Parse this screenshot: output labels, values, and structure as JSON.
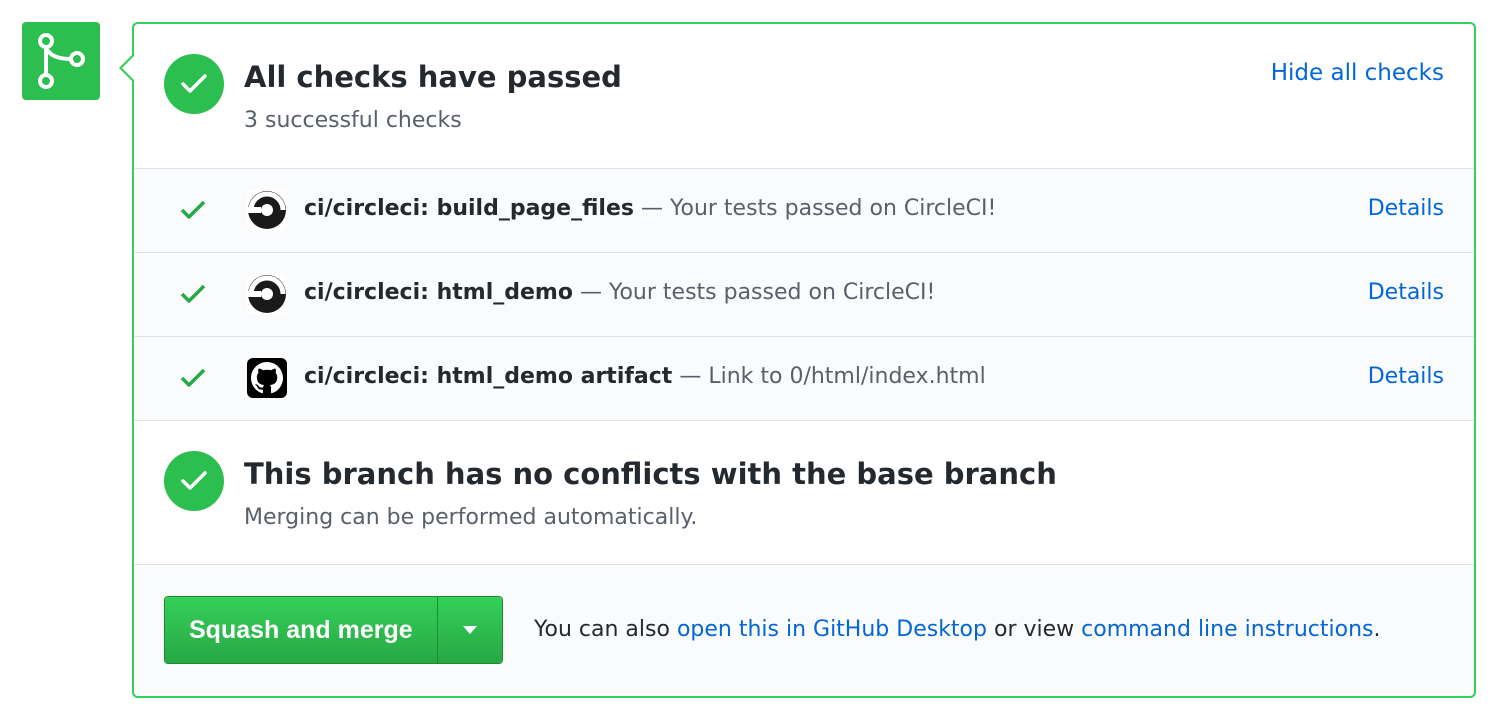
{
  "icons": {
    "merge": "git-merge-icon",
    "check": "check-icon",
    "circleci": "circleci-icon",
    "github": "github-icon",
    "caret": "triangle-down-icon"
  },
  "colors": {
    "success": "#2cbe4e",
    "border_success": "#34d058",
    "link": "#0366d6",
    "muted": "#586069"
  },
  "checks_summary": {
    "title": "All checks have passed",
    "subtitle": "3 successful checks",
    "toggle_label": "Hide all checks"
  },
  "checks": [
    {
      "name": "ci/circleci: build_page_files",
      "separator": " — ",
      "description": "Your tests passed on CircleCI!",
      "details_label": "Details",
      "avatar": "circleci-icon"
    },
    {
      "name": "ci/circleci: html_demo",
      "separator": " — ",
      "description": "Your tests passed on CircleCI!",
      "details_label": "Details",
      "avatar": "circleci-icon"
    },
    {
      "name": "ci/circleci: html_demo artifact",
      "separator": " — ",
      "description": "Link to 0/html/index.html",
      "details_label": "Details",
      "avatar": "github-icon"
    }
  ],
  "branch_status": {
    "title": "This branch has no conflicts with the base branch",
    "subtitle": "Merging can be performed automatically."
  },
  "merge": {
    "button_label": "Squash and merge",
    "note_prefix": "You can also ",
    "desktop_link": "open this in GitHub Desktop",
    "note_middle": " or view ",
    "cli_link": "command line instructions",
    "note_suffix": "."
  }
}
